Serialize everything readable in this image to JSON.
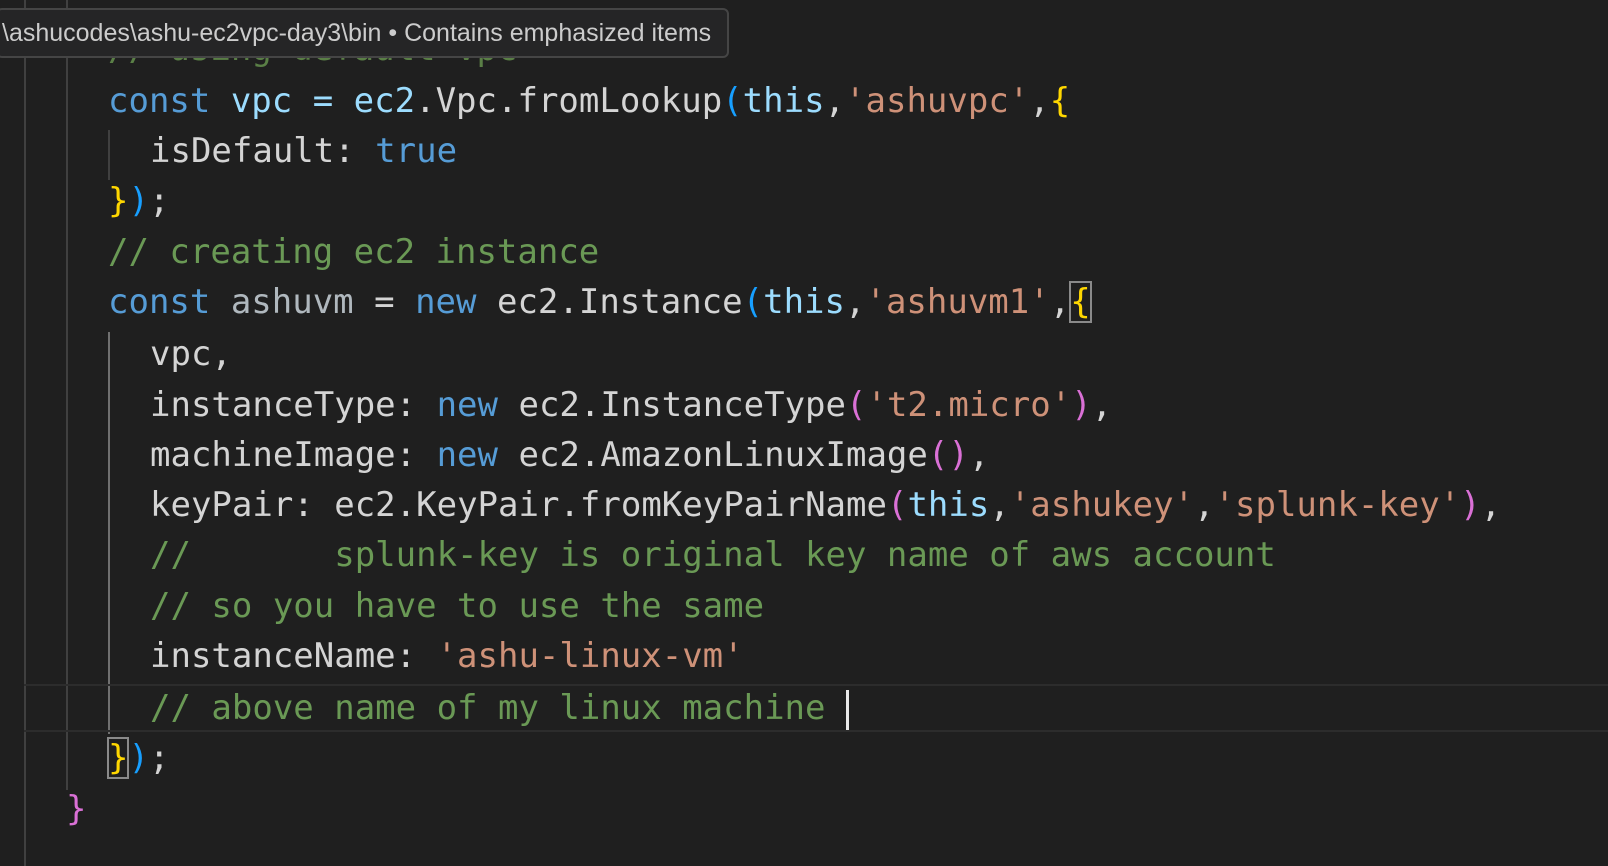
{
  "breadcrumb_tooltip": {
    "path": "\\ashucodes\\ashu-ec2vpc-day3\\bin",
    "separator": " • ",
    "status": "Contains emphasized items"
  },
  "code": {
    "cut_comment": "// using default vpc",
    "l1": {
      "const": "const",
      "name": " vpc = ",
      "obj": "ec2",
      "dot1": ".",
      "cls": "Vpc",
      "dot2": ".",
      "fn": "fromLookup",
      "open": "(",
      "this": "this",
      "comma1": ",",
      "arg": "'ashuvpc'",
      "comma2": ",",
      "brace": "{"
    },
    "l2": {
      "key": "isDefault: ",
      "value": "true"
    },
    "l3": {
      "brace": "}",
      "paren": ")",
      "semi": ";"
    },
    "l4": {
      "comment": "// creating ec2 instance"
    },
    "l5": {
      "const": "const",
      "name": " ashuvm",
      "eq": " = ",
      "new": "new",
      "obj": " ec2.",
      "cls": "Instance",
      "open": "(",
      "this": "this",
      "comma1": ",",
      "arg": "'ashuvm1'",
      "comma2": ",",
      "brace": "{"
    },
    "l6": {
      "text": "vpc,"
    },
    "l7": {
      "key": "instanceType: ",
      "new": "new",
      "obj": " ec2.",
      "cls": "InstanceType",
      "open": "(",
      "arg": "'t2.micro'",
      "close": ")",
      "comma": ","
    },
    "l8": {
      "key": "machineImage: ",
      "new": "new",
      "obj": " ec2.",
      "cls": "AmazonLinuxImage",
      "open": "(",
      "close": ")",
      "comma": ","
    },
    "l9": {
      "key": "keyPair: ",
      "obj": "ec2.",
      "cls": "KeyPair",
      "dot": ".",
      "fn": "fromKeyPairName",
      "open": "(",
      "this": "this",
      "comma1": ",",
      "arg1": "'ashukey'",
      "comma2": ",",
      "arg2": "'splunk-key'",
      "close": ")",
      "comma3": ","
    },
    "l10": {
      "comment": "//       splunk-key is original key name of aws account"
    },
    "l11": {
      "comment": "// so you have to use the same"
    },
    "l12": {
      "key": "instanceName: ",
      "value": "'ashu-linux-vm'"
    },
    "l13": {
      "comment": "// above name of my linux machine "
    },
    "l14": {
      "brace": "}",
      "paren": ")",
      "semi": ";"
    },
    "l15": {
      "brace": "}"
    }
  }
}
